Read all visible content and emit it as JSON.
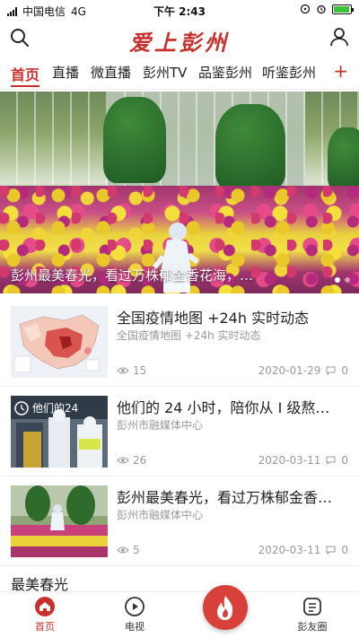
{
  "status_bar": {
    "carrier": "中国电信",
    "network": "4G",
    "time": "下午 2:43",
    "battery_level": 0.95
  },
  "header": {
    "logo_text": "爱上彭州",
    "search_icon": "search-icon",
    "profile_icon": "user-icon"
  },
  "tabs": [
    {
      "label": "首页",
      "active": true
    },
    {
      "label": "直播"
    },
    {
      "label": "微直播"
    },
    {
      "label": "彭州TV"
    },
    {
      "label": "品鉴彭州"
    },
    {
      "label": "听鉴彭州"
    }
  ],
  "tabs_add": "+",
  "banner": {
    "caption": "彭州最美春光，看过万株郁金香花海，…",
    "current_slide": 1,
    "slide_count": 2
  },
  "news": [
    {
      "title": "全国疫情地图 +24h 实时动态",
      "source": "全国疫情地图 +24h 实时动态",
      "views": "15",
      "date": "2020-01-29",
      "comments": "0"
    },
    {
      "title": "他们的 24 小时，陪你从 Ⅰ 级熬…",
      "source": "彭州市融媒体中心",
      "views": "26",
      "date": "2020-03-11",
      "comments": "0",
      "thumb_text": "他们的24"
    },
    {
      "title": "彭州最美春光，看过万株郁金香…",
      "source": "彭州市融媒体中心",
      "views": "5",
      "date": "2020-03-11",
      "comments": "0"
    }
  ],
  "section_title": "最美春光",
  "bottom_nav": [
    {
      "label": "首页",
      "icon": "home-icon",
      "active": true
    },
    {
      "label": "电视",
      "icon": "play-icon"
    },
    {
      "label": "",
      "icon": "flame-icon"
    },
    {
      "label": "彭友圈",
      "icon": "document-icon"
    }
  ],
  "colors": {
    "accent": "#c9302c",
    "fab": "#d7413a"
  }
}
